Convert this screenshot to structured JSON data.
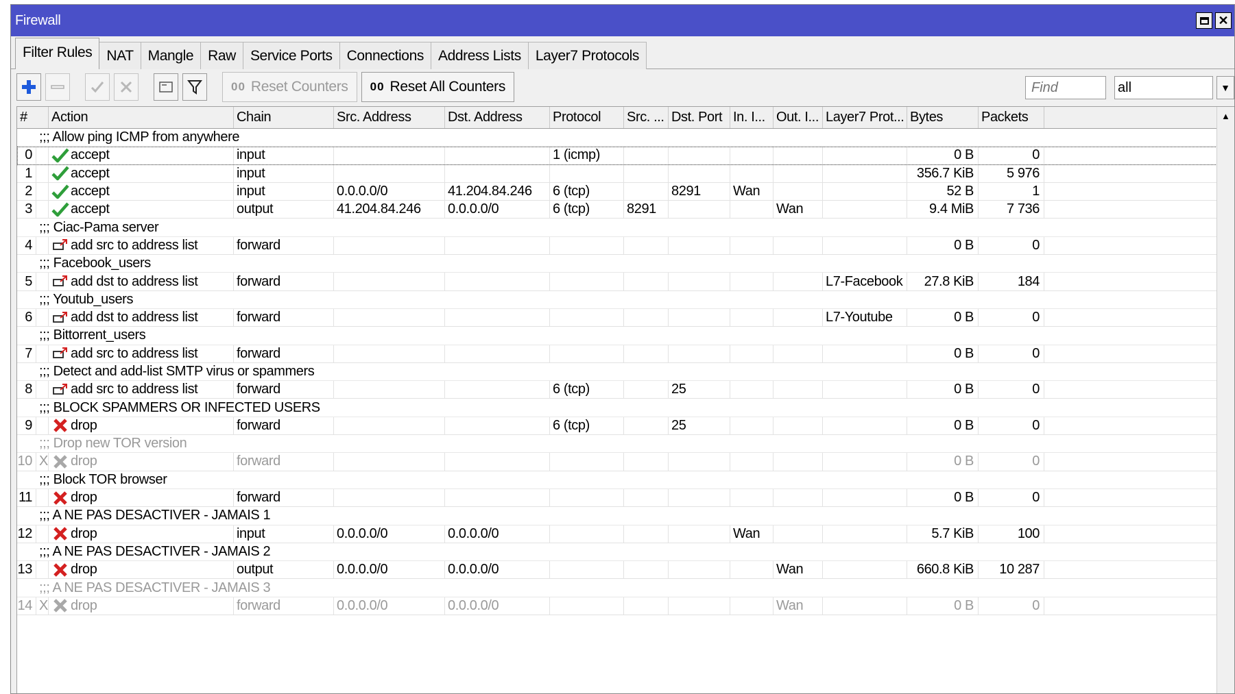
{
  "window": {
    "title": "Firewall"
  },
  "tabs": [
    "Filter Rules",
    "NAT",
    "Mangle",
    "Raw",
    "Service Ports",
    "Connections",
    "Address Lists",
    "Layer7 Protocols"
  ],
  "toolbar": {
    "reset_counters": "Reset Counters",
    "reset_all_counters": "Reset All Counters",
    "counter_glyph": "00",
    "find_placeholder": "Find",
    "filter_value": "all"
  },
  "columns": [
    "#",
    "Action",
    "Chain",
    "Src. Address",
    "Dst. Address",
    "Protocol",
    "Src. ...",
    "Dst. Port",
    "In. I...",
    "Out. I...",
    "Layer7 Prot...",
    "Bytes",
    "Packets"
  ],
  "rows": [
    {
      "type": "comment",
      "text": ";;; Allow ping ICMP from anywhere"
    },
    {
      "type": "rule",
      "idx": "0",
      "flag": "",
      "icon": "accept",
      "action": "accept",
      "chain": "input",
      "src": "",
      "dst": "",
      "proto": "1 (icmp)",
      "sport": "",
      "dport": "",
      "inif": "",
      "outif": "",
      "l7": "",
      "bytes": "0 B",
      "packets": "0",
      "selected": true
    },
    {
      "type": "rule",
      "idx": "1",
      "flag": "",
      "icon": "accept",
      "action": "accept",
      "chain": "input",
      "src": "",
      "dst": "",
      "proto": "",
      "sport": "",
      "dport": "",
      "inif": "",
      "outif": "",
      "l7": "",
      "bytes": "356.7 KiB",
      "packets": "5 976"
    },
    {
      "type": "rule",
      "idx": "2",
      "flag": "",
      "icon": "accept",
      "action": "accept",
      "chain": "input",
      "src": "0.0.0.0/0",
      "dst": "41.204.84.246",
      "proto": "6 (tcp)",
      "sport": "",
      "dport": "8291",
      "inif": "Wan",
      "outif": "",
      "l7": "",
      "bytes": "52 B",
      "packets": "1"
    },
    {
      "type": "rule",
      "idx": "3",
      "flag": "",
      "icon": "accept",
      "action": "accept",
      "chain": "output",
      "src": "41.204.84.246",
      "dst": "0.0.0.0/0",
      "proto": "6 (tcp)",
      "sport": "8291",
      "dport": "",
      "inif": "",
      "outif": "Wan",
      "l7": "",
      "bytes": "9.4 MiB",
      "packets": "7 736"
    },
    {
      "type": "comment",
      "text": ";;; Ciac-Pama server"
    },
    {
      "type": "rule",
      "idx": "4",
      "flag": "",
      "icon": "addlist",
      "action": "add src to address list",
      "chain": "forward",
      "src": "",
      "dst": "",
      "proto": "",
      "sport": "",
      "dport": "",
      "inif": "",
      "outif": "",
      "l7": "",
      "bytes": "0 B",
      "packets": "0"
    },
    {
      "type": "comment",
      "text": ";;; Facebook_users"
    },
    {
      "type": "rule",
      "idx": "5",
      "flag": "",
      "icon": "addlist",
      "action": "add dst to address list",
      "chain": "forward",
      "src": "",
      "dst": "",
      "proto": "",
      "sport": "",
      "dport": "",
      "inif": "",
      "outif": "",
      "l7": "L7-Facebook",
      "bytes": "27.8 KiB",
      "packets": "184"
    },
    {
      "type": "comment",
      "text": ";;; Youtub_users"
    },
    {
      "type": "rule",
      "idx": "6",
      "flag": "",
      "icon": "addlist",
      "action": "add dst to address list",
      "chain": "forward",
      "src": "",
      "dst": "",
      "proto": "",
      "sport": "",
      "dport": "",
      "inif": "",
      "outif": "",
      "l7": "L7-Youtube",
      "bytes": "0 B",
      "packets": "0"
    },
    {
      "type": "comment",
      "text": ";;; Bittorrent_users"
    },
    {
      "type": "rule",
      "idx": "7",
      "flag": "",
      "icon": "addlist",
      "action": "add src to address list",
      "chain": "forward",
      "src": "",
      "dst": "",
      "proto": "",
      "sport": "",
      "dport": "",
      "inif": "",
      "outif": "",
      "l7": "",
      "bytes": "0 B",
      "packets": "0"
    },
    {
      "type": "comment",
      "text": ";;; Detect and add-list SMTP virus or spammers"
    },
    {
      "type": "rule",
      "idx": "8",
      "flag": "",
      "icon": "addlist",
      "action": "add src to address list",
      "chain": "forward",
      "src": "",
      "dst": "",
      "proto": "6 (tcp)",
      "sport": "",
      "dport": "25",
      "inif": "",
      "outif": "",
      "l7": "",
      "bytes": "0 B",
      "packets": "0"
    },
    {
      "type": "comment",
      "text": ";;; BLOCK SPAMMERS OR INFECTED USERS"
    },
    {
      "type": "rule",
      "idx": "9",
      "flag": "",
      "icon": "drop",
      "action": "drop",
      "chain": "forward",
      "src": "",
      "dst": "",
      "proto": "6 (tcp)",
      "sport": "",
      "dport": "25",
      "inif": "",
      "outif": "",
      "l7": "",
      "bytes": "0 B",
      "packets": "0"
    },
    {
      "type": "comment",
      "text": ";;; Drop new TOR version",
      "disabled": true
    },
    {
      "type": "rule",
      "idx": "10",
      "flag": "X",
      "icon": "drop-disabled",
      "action": "drop",
      "chain": "forward",
      "src": "",
      "dst": "",
      "proto": "",
      "sport": "",
      "dport": "",
      "inif": "",
      "outif": "",
      "l7": "",
      "bytes": "0 B",
      "packets": "0",
      "disabled": true
    },
    {
      "type": "comment",
      "text": ";;; Block TOR browser"
    },
    {
      "type": "rule",
      "idx": "11",
      "flag": "",
      "icon": "drop",
      "action": "drop",
      "chain": "forward",
      "src": "",
      "dst": "",
      "proto": "",
      "sport": "",
      "dport": "",
      "inif": "",
      "outif": "",
      "l7": "",
      "bytes": "0 B",
      "packets": "0"
    },
    {
      "type": "comment",
      "text": ";;; A NE PAS DESACTIVER - JAMAIS 1"
    },
    {
      "type": "rule",
      "idx": "12",
      "flag": "",
      "icon": "drop",
      "action": "drop",
      "chain": "input",
      "src": "0.0.0.0/0",
      "dst": "0.0.0.0/0",
      "proto": "",
      "sport": "",
      "dport": "",
      "inif": "Wan",
      "outif": "",
      "l7": "",
      "bytes": "5.7 KiB",
      "packets": "100"
    },
    {
      "type": "comment",
      "text": ";;; A NE PAS DESACTIVER - JAMAIS 2"
    },
    {
      "type": "rule",
      "idx": "13",
      "flag": "",
      "icon": "drop",
      "action": "drop",
      "chain": "output",
      "src": "0.0.0.0/0",
      "dst": "0.0.0.0/0",
      "proto": "",
      "sport": "",
      "dport": "",
      "inif": "",
      "outif": "Wan",
      "l7": "",
      "bytes": "660.8 KiB",
      "packets": "10 287"
    },
    {
      "type": "comment",
      "text": ";;; A NE PAS DESACTIVER - JAMAIS 3",
      "disabled": true
    },
    {
      "type": "rule",
      "idx": "14",
      "flag": "X",
      "icon": "drop-disabled",
      "action": "drop",
      "chain": "forward",
      "src": "0.0.0.0/0",
      "dst": "0.0.0.0/0",
      "proto": "",
      "sport": "",
      "dport": "",
      "inif": "",
      "outif": "Wan",
      "l7": "",
      "bytes": "0 B",
      "packets": "0",
      "disabled": true
    }
  ],
  "colors": {
    "title_bar": "#4a50c8",
    "accept_icon": "#2e9e3a",
    "drop_icon": "#d42020",
    "add_icon": "#1e5adc",
    "disabled_text": "#9a9a9a"
  }
}
